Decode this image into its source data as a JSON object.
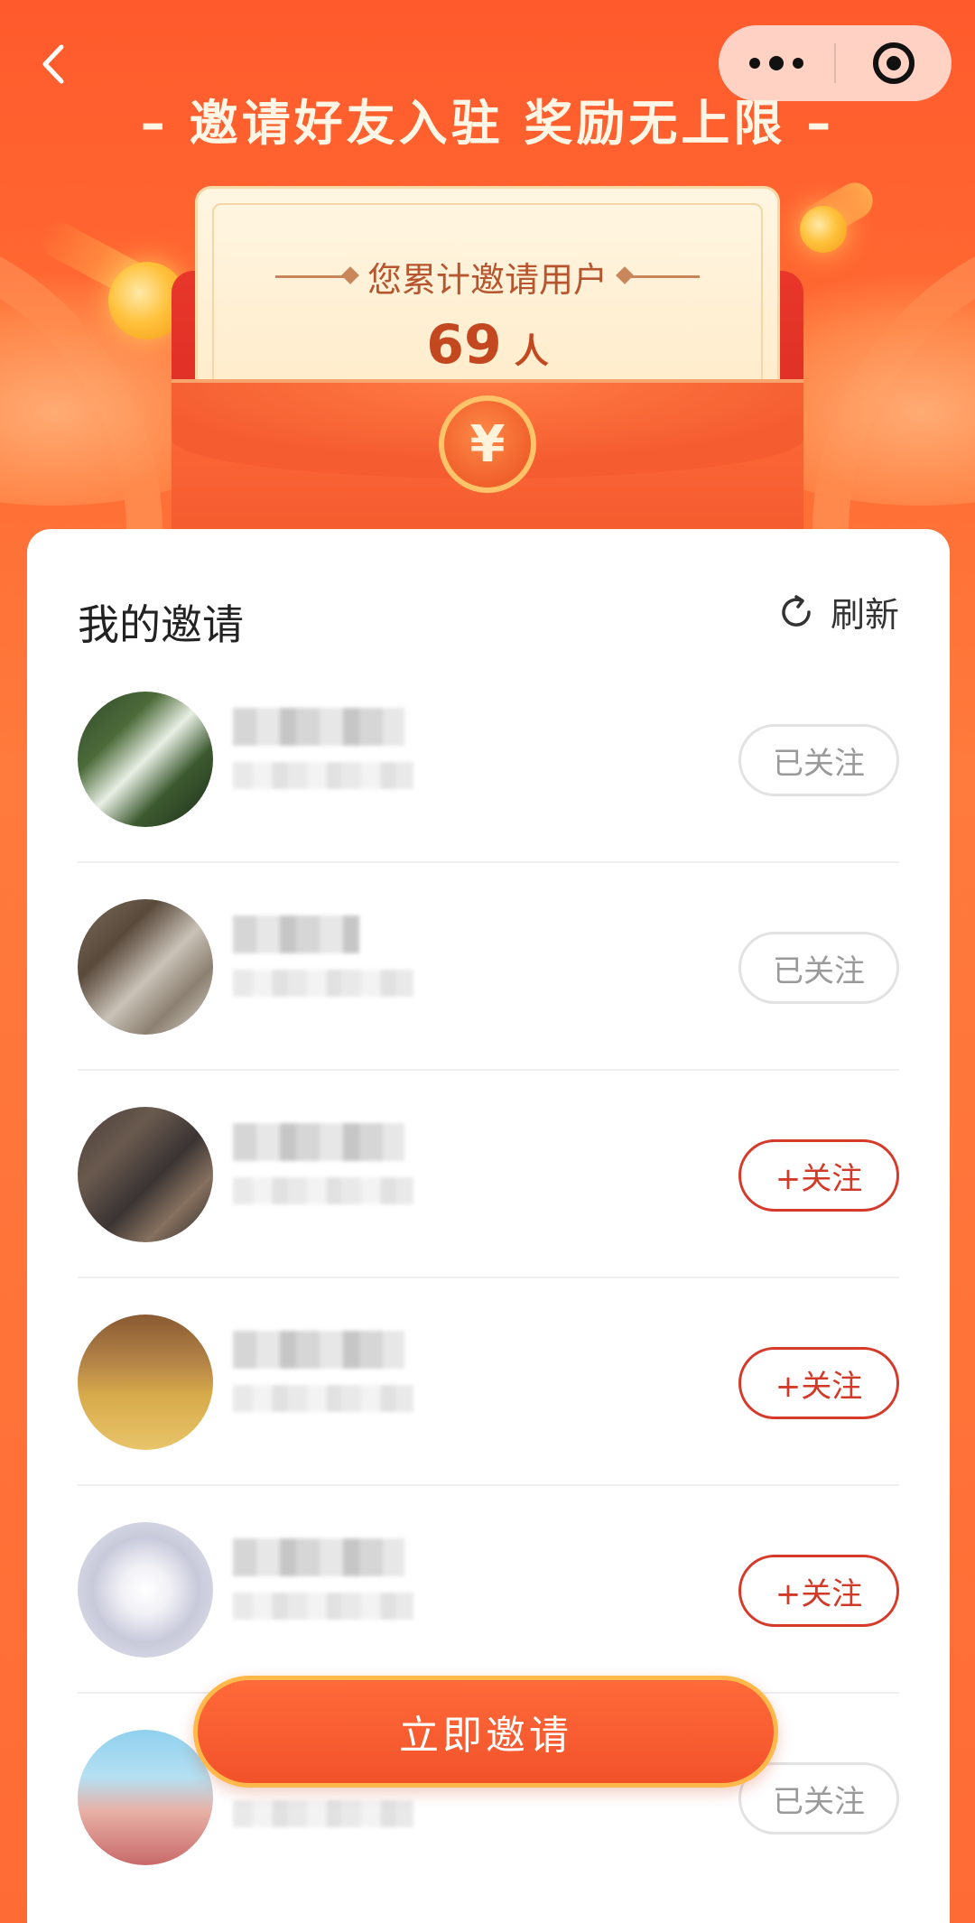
{
  "header": {
    "headline": "– 邀请好友入驻  奖励无上限 –"
  },
  "summary": {
    "label": "您累计邀请用户",
    "count": "69",
    "unit": "人",
    "yen_symbol": "¥"
  },
  "section": {
    "title": "我的邀请",
    "refresh_label": "刷新"
  },
  "invitees": [
    {
      "follow_label": "已关注",
      "followed": true
    },
    {
      "follow_label": "已关注",
      "followed": true
    },
    {
      "follow_label": "+关注",
      "followed": false
    },
    {
      "follow_label": "+关注",
      "followed": false
    },
    {
      "follow_label": "+关注",
      "followed": false
    },
    {
      "follow_label": "已关注",
      "followed": true
    }
  ],
  "cta": {
    "label": "立即邀请"
  },
  "icons": {
    "back": "back-chevron-icon",
    "more": "more-dots-icon",
    "close": "target-circle-icon",
    "refresh": "refresh-icon"
  },
  "colors": {
    "accent": "#d53a2a",
    "background": "#ff6b35",
    "followed_border": "#e2e2e2",
    "cta_border": "#ffb84a"
  }
}
